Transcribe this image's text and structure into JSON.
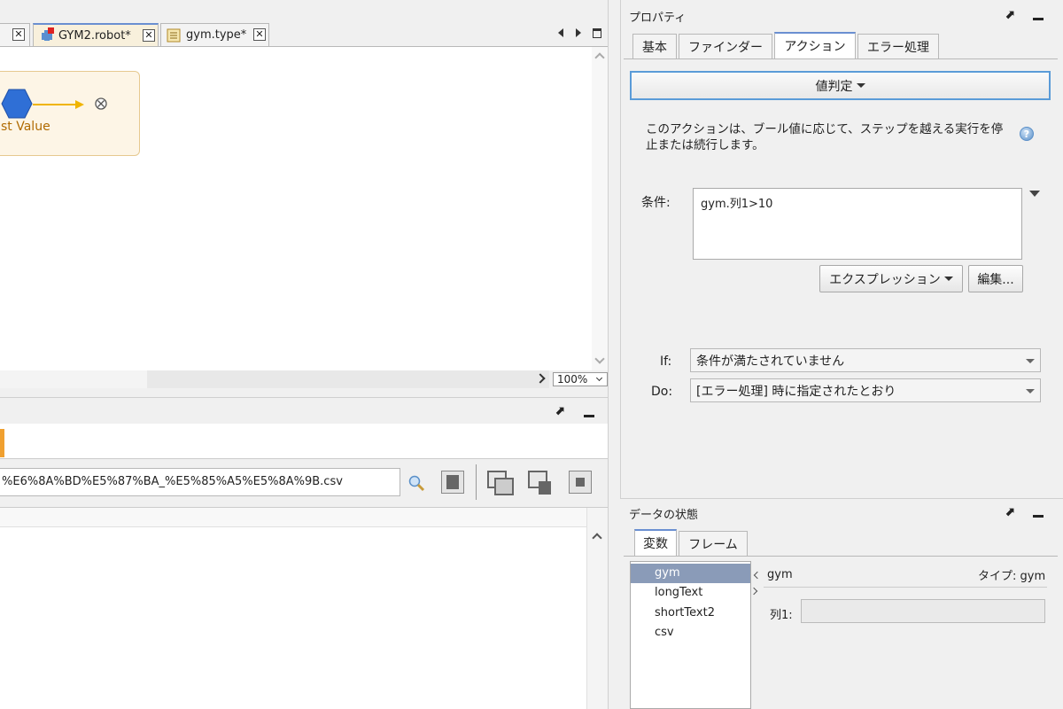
{
  "editor": {
    "tabs": [
      {
        "label": "GYM2.robot*"
      },
      {
        "label": "gym.type*"
      }
    ],
    "close_glyph": "✕",
    "canvas": {
      "step_label": "st Value"
    },
    "zoom": "100%"
  },
  "bottom_panel": {
    "url_value": "%E6%8A%BD%E5%87%BA_%E5%85%A5%E5%8A%9B.csv"
  },
  "properties": {
    "title": "プロパティ",
    "tabs": [
      {
        "label": "基本"
      },
      {
        "label": "ファインダー"
      },
      {
        "label": "アクション"
      },
      {
        "label": "エラー処理"
      }
    ],
    "action_button": "値判定",
    "description": "このアクションは、ブール値に応じて、ステップを越える実行を停止または続行します。",
    "condition_label": "条件:",
    "condition_value": "gym.列1>10",
    "expression_button": "エクスプレッション",
    "edit_button": "編集...",
    "if_label": "If:",
    "if_value": "条件が満たされていません",
    "do_label": "Do:",
    "do_value": "[エラー処理] 時に指定されたとおり",
    "help_glyph": "?"
  },
  "data_state": {
    "title": "データの状態",
    "tabs": [
      {
        "label": "変数"
      },
      {
        "label": "フレーム"
      }
    ],
    "variables": [
      "gym",
      "longText",
      "shortText2",
      "csv"
    ],
    "selected_variable": "gym",
    "detail_name": "gym",
    "detail_type": "タイプ: gym",
    "field_label": "列1:",
    "field_value": ""
  },
  "colors": {
    "accent_blue": "#5a9bd8",
    "hex_node": "#2f6fd6",
    "selection": "#8a9bb8",
    "step_bg": "#fdf5e6",
    "arrow": "#f0b400"
  }
}
